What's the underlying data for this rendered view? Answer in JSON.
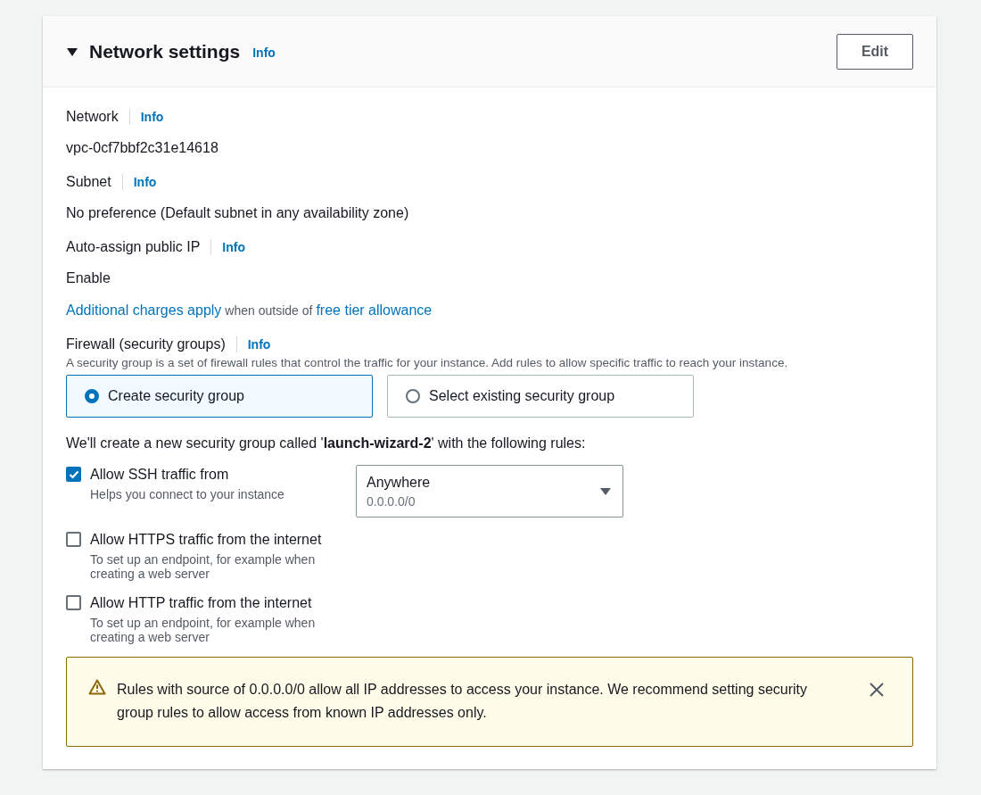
{
  "section": {
    "title": "Network settings",
    "info": "Info",
    "expanded": true,
    "edit_button": "Edit"
  },
  "fields": [
    {
      "label": "Network",
      "info": "Info",
      "value": "vpc-0cf7bbf2c31e14618"
    },
    {
      "label": "Subnet",
      "info": "Info",
      "value": "No preference (Default subnet in any availability zone)"
    },
    {
      "label": "Auto-assign public IP",
      "info": "Info",
      "value": "Enable"
    }
  ],
  "charges_note": {
    "link_1": "Additional charges apply",
    "text": "when outside of",
    "link_2": "free tier allowance"
  },
  "firewall": {
    "label": "Firewall (security groups)",
    "info": "Info",
    "description": "A security group is a set of firewall rules that control the traffic for your instance. Add rules to allow specific traffic to reach your instance.",
    "options": [
      {
        "label": "Create security group",
        "selected": true
      },
      {
        "label": "Select existing security group",
        "selected": false
      }
    ]
  },
  "rules_intro": "We'll create a new security group called '**launch-wizard-2**' with the following rules:",
  "rules": [
    {
      "label": "Allow SSH traffic from",
      "hint": "Helps you connect to your instance",
      "checked": true,
      "source": {
        "value": "Anywhere",
        "detail": "0.0.0.0/0"
      }
    },
    {
      "label": "Allow HTTPS traffic from the internet",
      "hint": "To set up an endpoint, for example when creating a web server",
      "checked": false
    },
    {
      "label": "Allow HTTP traffic from the internet",
      "hint": "To set up an endpoint, for example when creating a web server",
      "checked": false
    }
  ],
  "warning": {
    "text": "Rules with source of 0.0.0.0/0 allow all IP addresses to access your instance. We recommend setting security group rules to allow access from known IP addresses only."
  }
}
